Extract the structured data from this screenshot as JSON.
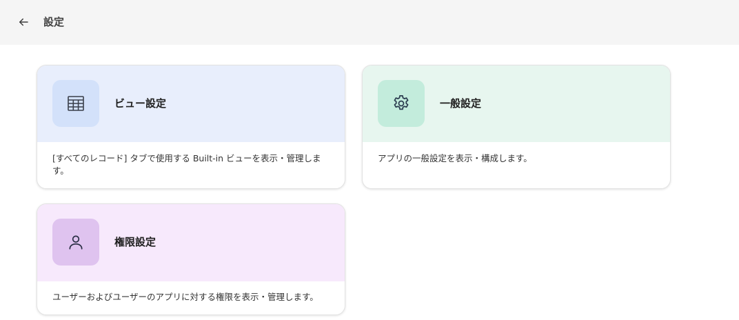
{
  "header": {
    "title": "設定",
    "back_icon": "arrow-left-icon"
  },
  "cards": [
    {
      "title": "ビュー設定",
      "description": "[すべてのレコード] タブで使用する Built-in ビューを表示・管理しま す。",
      "icon": "table-grid-icon",
      "head_color": "#e8eefc",
      "icon_bg": "#d3e1fa",
      "icon_color": "#3a3f4a"
    },
    {
      "title": "一般設定",
      "description": "アプリの一般設定を表示・構成します。",
      "icon": "gear-icon",
      "head_color": "#e7f6ef",
      "icon_bg": "#c3ecdc",
      "icon_color": "#2c3e50"
    },
    {
      "title": "権限設定",
      "description": "ユーザーおよびユーザーのアプリに対する権限を表示・管理します。",
      "icon": "person-icon",
      "head_color": "#f7e9fc",
      "icon_bg": "#dfc3ef",
      "icon_color": "#2a2f45"
    }
  ]
}
